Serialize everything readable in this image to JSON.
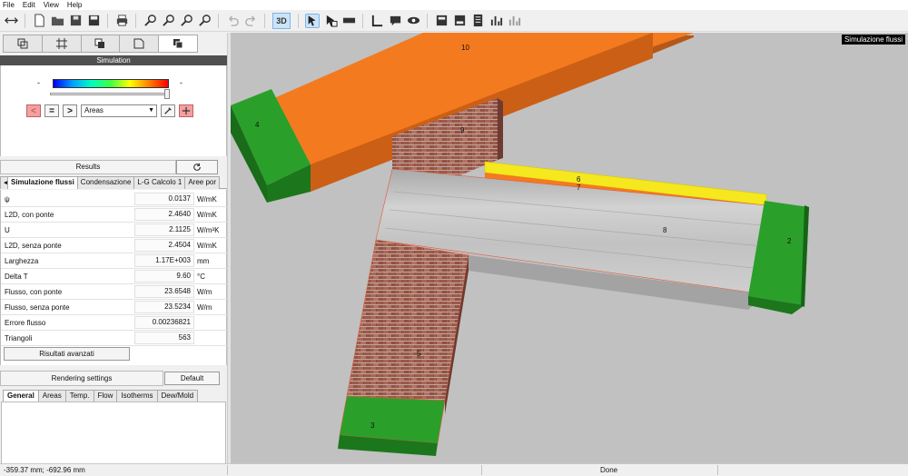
{
  "menu": [
    "File",
    "Edit",
    "View",
    "Help"
  ],
  "toolbar": {
    "mode_3d": "3D",
    "icons": [
      "swap-arrows-icon",
      "new-file-icon",
      "open-folder-icon",
      "save-as-icon",
      "save-icon",
      "print-icon",
      "zoom-in-icon",
      "zoom-out-icon",
      "zoom-window-icon",
      "zoom-fit-icon",
      "undo-icon",
      "redo-icon",
      "select-arrow-icon",
      "select-area-icon",
      "ruler-icon",
      "axis-icon",
      "comment-icon",
      "eye-icon",
      "export-icon",
      "export-icon-2",
      "report-icon",
      "chart-icon",
      "chart-icon-2"
    ]
  },
  "left": {
    "simulation_title": "Simulation",
    "colorbar_min": "-",
    "colorbar_max": "-",
    "controls": {
      "prev_label": "<",
      "equal_label": "=",
      "next_label": ">",
      "display_select": "Areas"
    },
    "results_label": "Results",
    "result_tabs": [
      "Simulazione flussi",
      "Condensazione",
      "L-G Calcolo 1",
      "Aree por"
    ],
    "rows": [
      {
        "label": "ψ",
        "value": "0.0137",
        "unit": "W/mK"
      },
      {
        "label": "L2D, con ponte",
        "value": "2.4640",
        "unit": "W/mK"
      },
      {
        "label": "U",
        "value": "2.1125",
        "unit": "W/m²K"
      },
      {
        "label": "L2D, senza ponte",
        "value": "2.4504",
        "unit": "W/mK"
      },
      {
        "label": "Larghezza",
        "value": "1.17E+003",
        "unit": "mm"
      },
      {
        "label": "Delta T",
        "value": "9.60",
        "unit": "°C"
      },
      {
        "label": "Flusso, con ponte",
        "value": "23.6548",
        "unit": "W/m"
      },
      {
        "label": "Flusso, senza ponte",
        "value": "23.5234",
        "unit": "W/m"
      },
      {
        "label": "Errore flusso",
        "value": "0.00236821",
        "unit": ""
      },
      {
        "label": "Triangoli",
        "value": "563",
        "unit": ""
      }
    ],
    "advanced_button": "Risultati avanzati",
    "rendering_label": "Rendering settings",
    "default_button": "Default",
    "render_tabs": [
      "General",
      "Areas",
      "Temp.",
      "Flow",
      "Isotherms",
      "Dew/Mold"
    ],
    "progress": 1.0
  },
  "view": {
    "title": "Simulazione flussi",
    "labels": [
      "10",
      "4",
      "9",
      "6",
      "7",
      "8",
      "2",
      "5",
      "3"
    ],
    "colors": {
      "orange": "#f47a1f",
      "green": "#2aa02a",
      "yellow": "#f5e81e",
      "concrete": "#b9b9b9",
      "brick": "#9c5a4a",
      "background": "#c1c1c1"
    }
  },
  "status": {
    "coords": "-359.37 mm; -692.96 mm",
    "state": "Done"
  }
}
